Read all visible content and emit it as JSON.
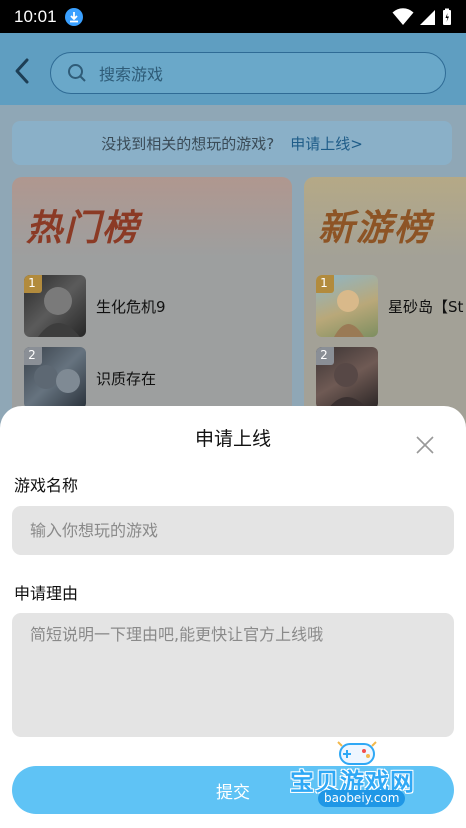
{
  "status_bar": {
    "time": "10:01"
  },
  "search": {
    "placeholder": "搜索游戏"
  },
  "banner": {
    "question": "没找到相关的想玩的游戏?",
    "link": "申请上线>"
  },
  "hot_list": {
    "title": "热门榜",
    "items": [
      {
        "rank": "1",
        "name": "生化危机9"
      },
      {
        "rank": "2",
        "name": "识质存在"
      }
    ]
  },
  "new_list": {
    "title": "新游榜",
    "items": [
      {
        "rank": "1",
        "name": "星砂岛【St"
      },
      {
        "rank": "2",
        "name": ""
      }
    ]
  },
  "sheet": {
    "title": "申请上线",
    "game_name_label": "游戏名称",
    "game_name_placeholder": "输入你想玩的游戏",
    "reason_label": "申请理由",
    "reason_placeholder": "简短说明一下理由吧,能更快让官方上线哦",
    "submit_label": "提交"
  },
  "watermark": {
    "text": "宝贝游戏网",
    "url": "baobeiy.com"
  },
  "colors": {
    "accent": "#5fc3f5",
    "input_bg": "#e4e4e4",
    "hot_title": "#8b3a25",
    "new_title": "#8d5425"
  }
}
